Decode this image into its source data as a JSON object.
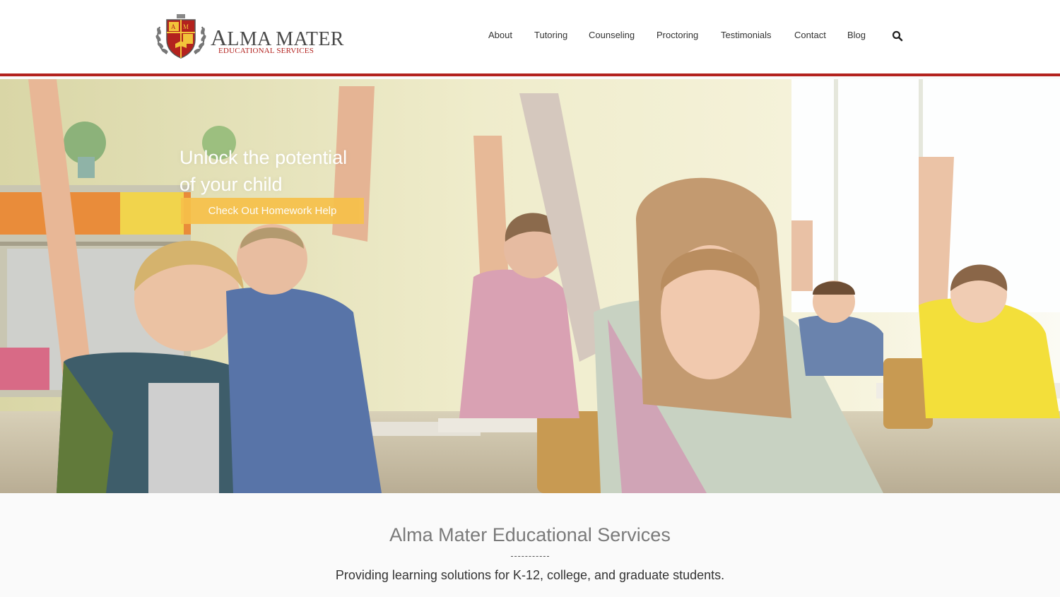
{
  "brand": {
    "crest_letters": "AM",
    "name_first_letter": "A",
    "name_rest": "LMA MATER",
    "tagline": "EDUCATIONAL SERVICES",
    "accent_color": "#b3221e"
  },
  "nav": {
    "items": [
      {
        "label": "About"
      },
      {
        "label": "Tutoring"
      },
      {
        "label": "Counseling"
      },
      {
        "label": "Proctoring"
      },
      {
        "label": "Testimonials"
      },
      {
        "label": "Contact"
      },
      {
        "label": "Blog"
      }
    ],
    "search_icon": "search-icon"
  },
  "hero": {
    "title_line1": "Unlock the potential",
    "title_line2": "of your child",
    "cta_label": "Check Out Homework Help",
    "cta_color": "#f7c14a"
  },
  "intro": {
    "title": "Alma Mater Educational Services",
    "subtitle": "Providing learning solutions for K-12, college, and graduate students."
  }
}
